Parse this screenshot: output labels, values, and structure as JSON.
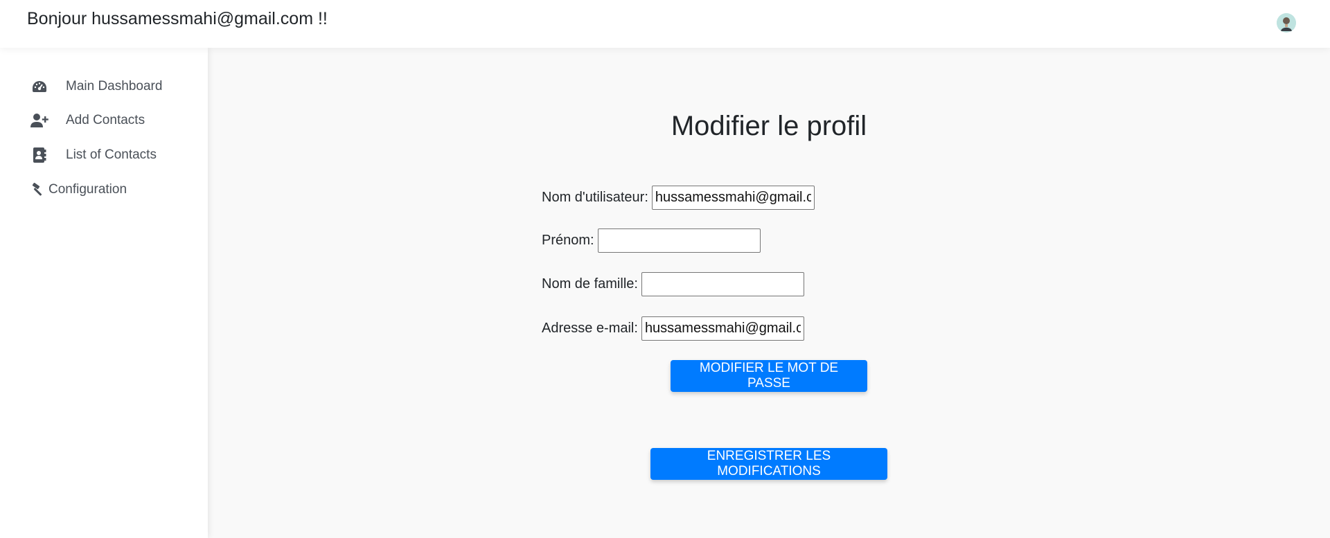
{
  "header": {
    "greeting": "Bonjour hussamessmahi@gmail.com !!"
  },
  "sidebar": {
    "items": [
      {
        "label": "Main Dashboard",
        "icon": "dashboard-gauge-icon"
      },
      {
        "label": "Add Contacts",
        "icon": "user-plus-icon"
      },
      {
        "label": "List of Contacts",
        "icon": "address-book-icon"
      },
      {
        "label": "Configuration",
        "icon": "hammer-icon"
      }
    ]
  },
  "main": {
    "title": "Modifier le profil",
    "fields": {
      "username": {
        "label": "Nom d'utilisateur:",
        "value": "hussamessmahi@gmail.com"
      },
      "first_name": {
        "label": "Prénom:",
        "value": ""
      },
      "last_name": {
        "label": "Nom de famille:",
        "value": ""
      },
      "email": {
        "label": "Adresse e-mail:",
        "value": "hussamessmahi@gmail.com"
      }
    },
    "change_password_label": "MODIFIER LE MOT DE PASSE",
    "save_label": "ENREGISTRER LES MODIFICATIONS"
  },
  "colors": {
    "primary": "#007bff",
    "background": "#f9f9f9",
    "sidebar_text": "#4a5058"
  }
}
